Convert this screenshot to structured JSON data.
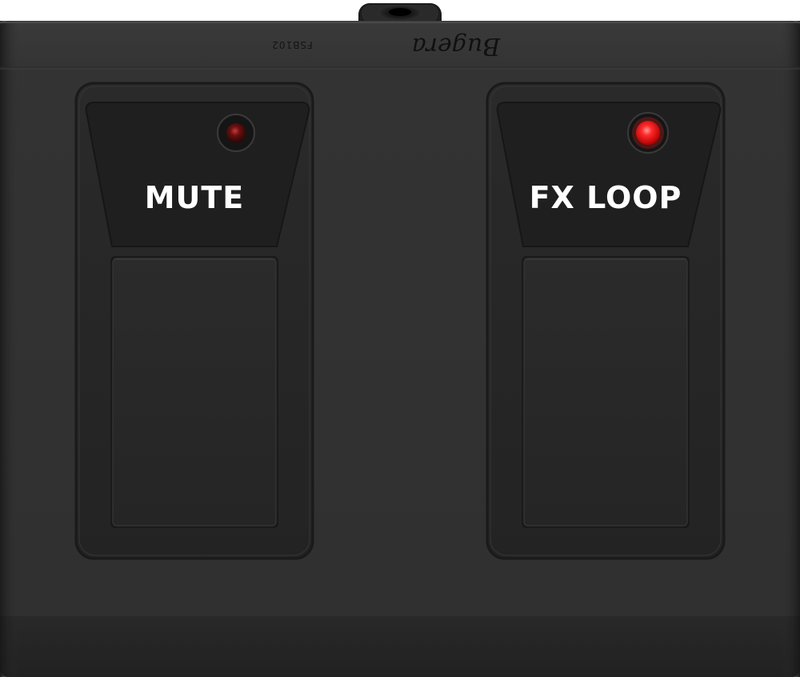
{
  "device": {
    "brand": "Bugera",
    "model": "FSB102",
    "colors": {
      "body": "#333333",
      "led_on": "#ff2020",
      "led_off": "#5a0b0b",
      "label_text": "#ffffff"
    }
  },
  "switches": [
    {
      "label": "MUTE",
      "led_state": "off"
    },
    {
      "label": "FX LOOP",
      "led_state": "on"
    }
  ]
}
